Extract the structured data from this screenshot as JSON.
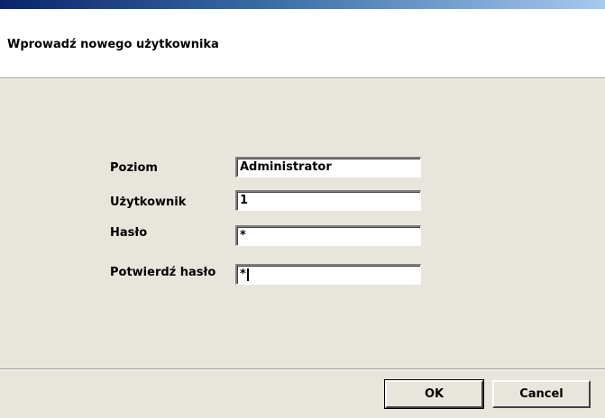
{
  "dialog": {
    "title": "Wprowadź nowego użytkownika"
  },
  "form": {
    "level_label": "Poziom",
    "level_value": "Administrator",
    "user_label": "Użytkownik",
    "user_value": "1",
    "password_label": "Hasło",
    "password_value": "*",
    "confirm_label": "Potwierdź hasło",
    "confirm_value": "*"
  },
  "buttons": {
    "ok": "OK",
    "cancel": "Cancel"
  },
  "colors": {
    "panel_bg": "#e8e6dc",
    "title_bar_start": "#0a246a",
    "title_bar_end": "#a6caf0"
  }
}
